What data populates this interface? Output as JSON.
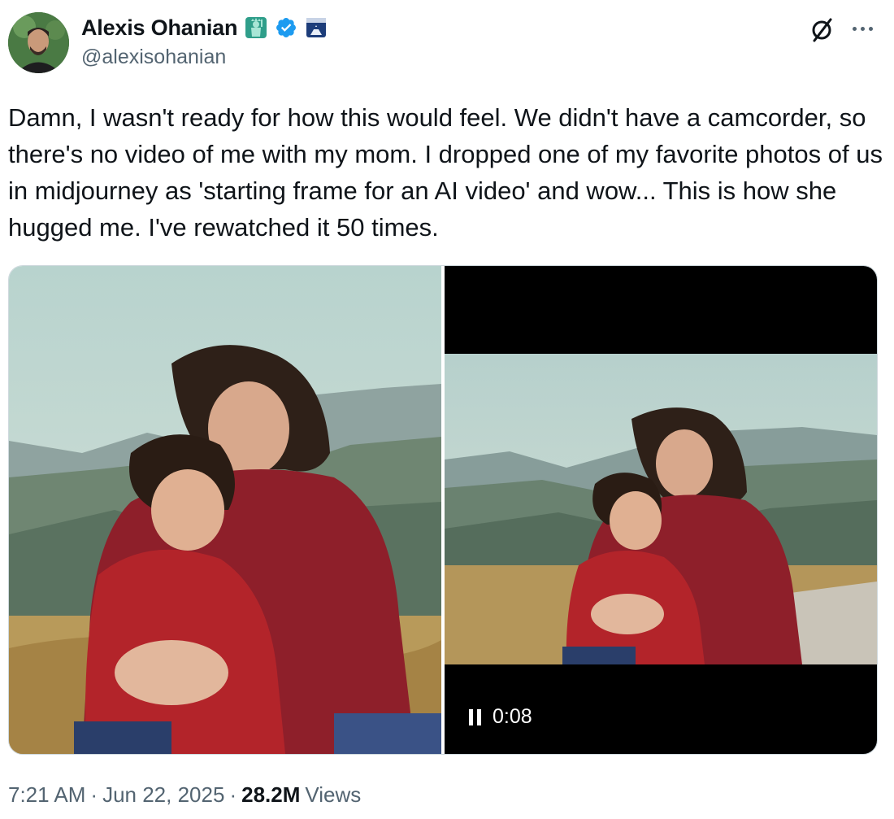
{
  "author": {
    "display_name": "Alexis Ohanian",
    "handle": "@alexisohanian",
    "verified_color": "#1d9bf0",
    "badges": [
      "statue-of-liberty-icon",
      "verified-badge-icon",
      "776-flag-icon"
    ]
  },
  "header_actions": {
    "grok_icon": "grok-slash-icon",
    "more_icon": "more-options-icon"
  },
  "tweet": {
    "text": "Damn, I wasn't ready for how this would feel. We didn't have a camcorder, so there's no video of me with my mom. I dropped one of my favorite photos of us in midjourney as 'starting frame for an AI video' and wow... This is how she hugged me. I've rewatched it 50 times."
  },
  "media": {
    "video_time": "0:08"
  },
  "meta": {
    "time": "7:21 AM",
    "separator": "·",
    "date": "Jun 22, 2025",
    "views_count": "28.2M",
    "views_label": "Views"
  }
}
